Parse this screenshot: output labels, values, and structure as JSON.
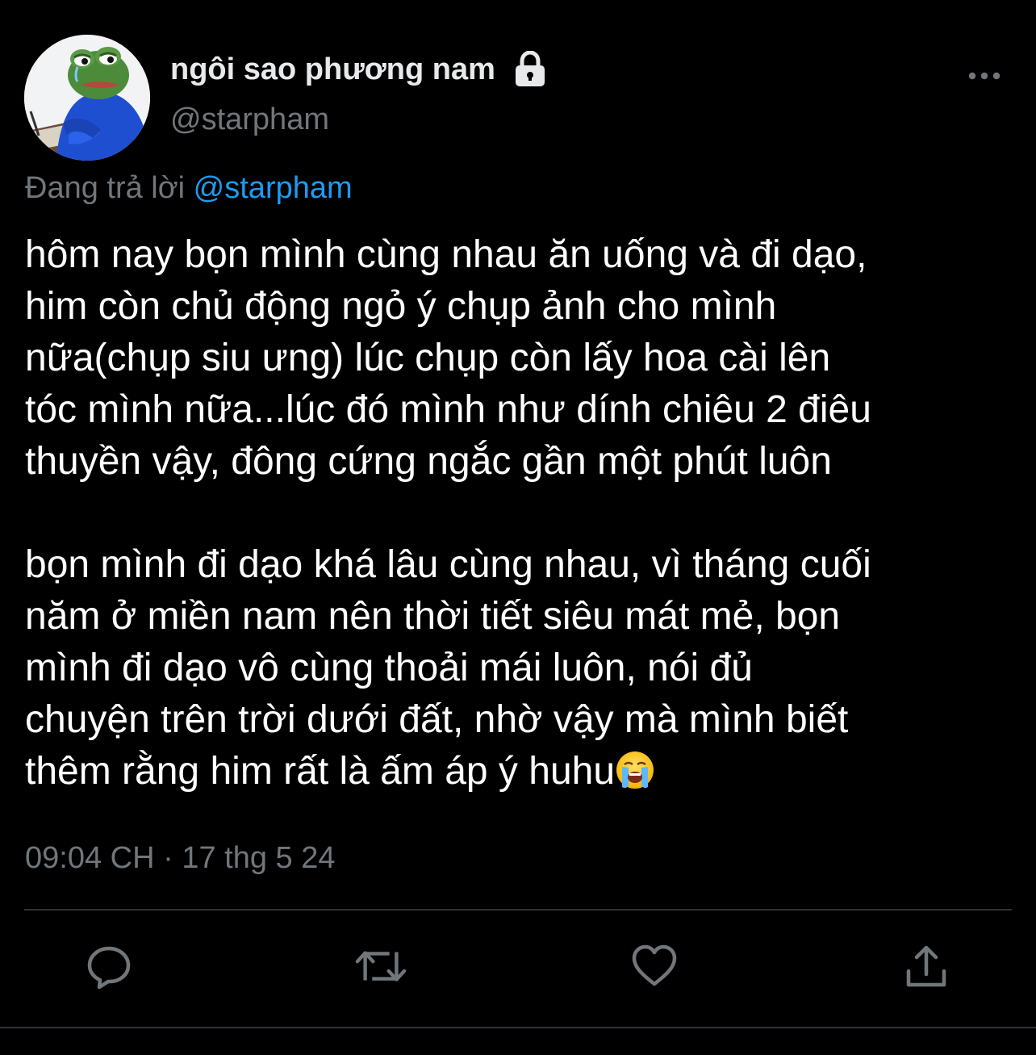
{
  "user": {
    "display_name": "ngôi sao phương nam",
    "handle": "@starpham",
    "protected_icon": "lock-icon",
    "avatar_icon": "frog-avatar"
  },
  "reply": {
    "prefix": "Đang trả lời",
    "handle": "@starpham"
  },
  "tweet": {
    "paragraph_1": "hôm nay bọn mình cùng nhau ăn uống và đi dạo,\nhim còn chủ động ngỏ ý chụp ảnh cho mình\nnữa(chụp siu ưng) lúc chụp còn lấy hoa cài lên\ntóc mình nữa...lúc đó mình như dính chiêu 2 điêu\nthuyền vậy, đông cứng ngắc gần một phút luôn",
    "paragraph_2": "bọn mình đi dạo khá lâu cùng nhau, vì tháng cuối\nnăm ở miền nam nên thời tiết siêu mát mẻ, bọn\nmình đi dạo vô cùng thoải mái luôn, nói đủ\nchuyện trên trời dưới đất, nhờ vậy mà mình biết\nthêm rằng him rất là ấm áp ý huhu",
    "emoji": "loudly-crying-face"
  },
  "meta": {
    "time": "09:04 CH",
    "separator": "·",
    "date": "17 thg 5 24"
  },
  "actions": {
    "reply_icon": "reply-icon",
    "retweet_icon": "retweet-icon",
    "like_icon": "heart-icon",
    "share_icon": "share-icon",
    "more_icon": "more-icon"
  },
  "colors": {
    "background": "#000000",
    "text": "#ffffff",
    "secondary": "#71767b",
    "link": "#1d9bf0",
    "divider": "#2f3336"
  }
}
